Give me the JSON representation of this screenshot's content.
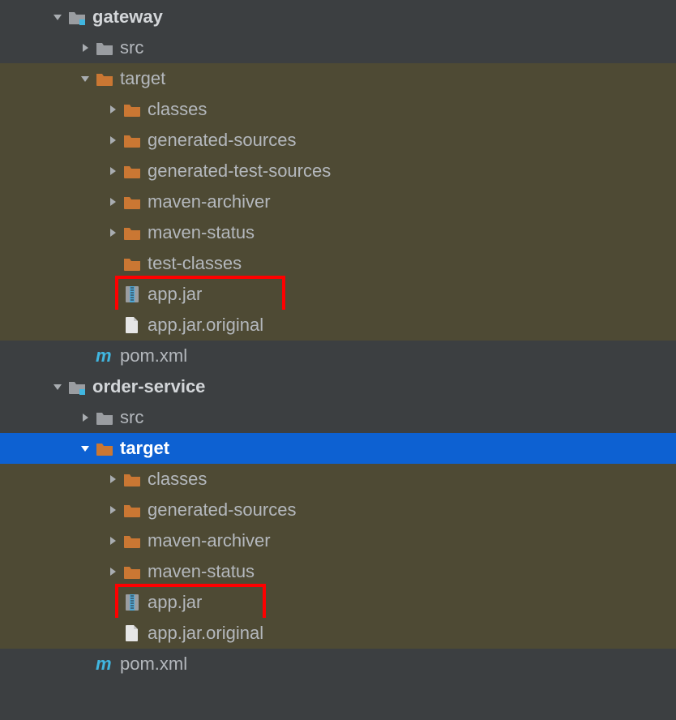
{
  "tree": {
    "gateway": {
      "name": "gateway",
      "src": "src",
      "target": {
        "name": "target",
        "classes": "classes",
        "generated_sources": "generated-sources",
        "generated_test_sources": "generated-test-sources",
        "maven_archiver": "maven-archiver",
        "maven_status": "maven-status",
        "test_classes": "test-classes",
        "app_jar": "app.jar",
        "app_jar_original": "app.jar.original"
      },
      "pom": "pom.xml"
    },
    "order_service": {
      "name": "order-service",
      "src": "src",
      "target": {
        "name": "target",
        "classes": "classes",
        "generated_sources": "generated-sources",
        "maven_archiver": "maven-archiver",
        "maven_status": "maven-status",
        "app_jar": "app.jar",
        "app_jar_original": "app.jar.original"
      },
      "pom": "pom.xml"
    }
  },
  "colors": {
    "folder_orange": "#ca7733",
    "folder_gray": "#9a9da1",
    "module_blue": "#56a8f5",
    "maven_blue": "#40b6e0",
    "archive_band": "#4fa6d4",
    "file_white": "#e6e6e6",
    "selection": "#0d61d2",
    "highlight_bg": "#4e4a34"
  }
}
